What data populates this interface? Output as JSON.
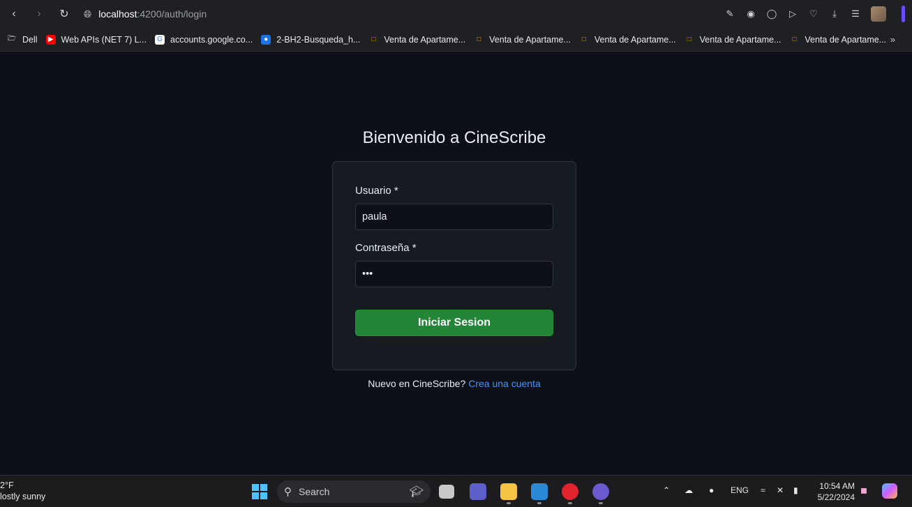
{
  "browser": {
    "url_host": "localhost",
    "url_path": ":4200/auth/login",
    "bookmarks": [
      {
        "label": "Dell",
        "icon": "folder-icon"
      },
      {
        "label": "Web APIs (NET 7) L...",
        "icon": "youtube-icon"
      },
      {
        "label": "accounts.google.co...",
        "icon": "google-icon"
      },
      {
        "label": "2-BH2-Busqueda_h...",
        "icon": "globe-icon"
      },
      {
        "label": "Venta de Apartame...",
        "icon": "listing-icon"
      },
      {
        "label": "Venta de Apartame...",
        "icon": "listing-icon"
      },
      {
        "label": "Venta de Apartame...",
        "icon": "listing-icon"
      },
      {
        "label": "Venta de Apartame...",
        "icon": "listing-icon"
      },
      {
        "label": "Venta de Apartame...",
        "icon": "listing-icon"
      }
    ]
  },
  "page": {
    "title": "Bienvenido a CineScribe",
    "form": {
      "username_label": "Usuario *",
      "username_value": "paula",
      "password_label": "Contraseña *",
      "password_value": "•••",
      "submit_label": "Iniciar Sesion"
    },
    "signup": {
      "prompt": "Nuevo en CineScribe?",
      "link": "Crea una cuenta"
    }
  },
  "taskbar": {
    "weather_temp": "2°F",
    "weather_desc": "lostly sunny",
    "search_label": "Search",
    "lang": "ENG",
    "time": "10:54 AM",
    "date": "5/22/2024"
  },
  "colors": {
    "background": "#0d1117",
    "card": "#161b22",
    "button": "#238636",
    "link": "#4493f8"
  }
}
